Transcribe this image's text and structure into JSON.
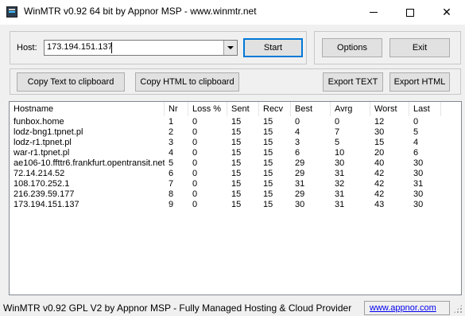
{
  "window": {
    "title": "WinMTR v0.92 64 bit by Appnor MSP - www.winmtr.net"
  },
  "host": {
    "label": "Host:",
    "value": "173.194.151.137"
  },
  "buttons": {
    "start": "Start",
    "options": "Options",
    "exit": "Exit",
    "copy_text": "Copy Text to clipboard",
    "copy_html": "Copy HTML to clipboard",
    "export_text": "Export TEXT",
    "export_html": "Export HTML"
  },
  "table": {
    "columns": [
      "Hostname",
      "Nr",
      "Loss %",
      "Sent",
      "Recv",
      "Best",
      "Avrg",
      "Worst",
      "Last"
    ],
    "rows": [
      [
        "funbox.home",
        "1",
        "0",
        "15",
        "15",
        "0",
        "0",
        "12",
        "0"
      ],
      [
        "lodz-bng1.tpnet.pl",
        "2",
        "0",
        "15",
        "15",
        "4",
        "7",
        "30",
        "5"
      ],
      [
        "lodz-r1.tpnet.pl",
        "3",
        "0",
        "15",
        "15",
        "3",
        "5",
        "15",
        "4"
      ],
      [
        "war-r1.tpnet.pl",
        "4",
        "0",
        "15",
        "15",
        "6",
        "10",
        "20",
        "6"
      ],
      [
        "ae106-10.ffttr6.frankfurt.opentransit.net",
        "5",
        "0",
        "15",
        "15",
        "29",
        "30",
        "40",
        "30"
      ],
      [
        "72.14.214.52",
        "6",
        "0",
        "15",
        "15",
        "29",
        "31",
        "42",
        "30"
      ],
      [
        "108.170.252.1",
        "7",
        "0",
        "15",
        "15",
        "31",
        "32",
        "42",
        "31"
      ],
      [
        "216.239.59.177",
        "8",
        "0",
        "15",
        "15",
        "29",
        "31",
        "42",
        "30"
      ],
      [
        "173.194.151.137",
        "9",
        "0",
        "15",
        "15",
        "30",
        "31",
        "43",
        "30"
      ]
    ]
  },
  "status": {
    "text": "WinMTR v0.92 GPL V2 by Appnor MSP - Fully Managed Hosting & Cloud Provider",
    "link": "www.appnor.com"
  }
}
